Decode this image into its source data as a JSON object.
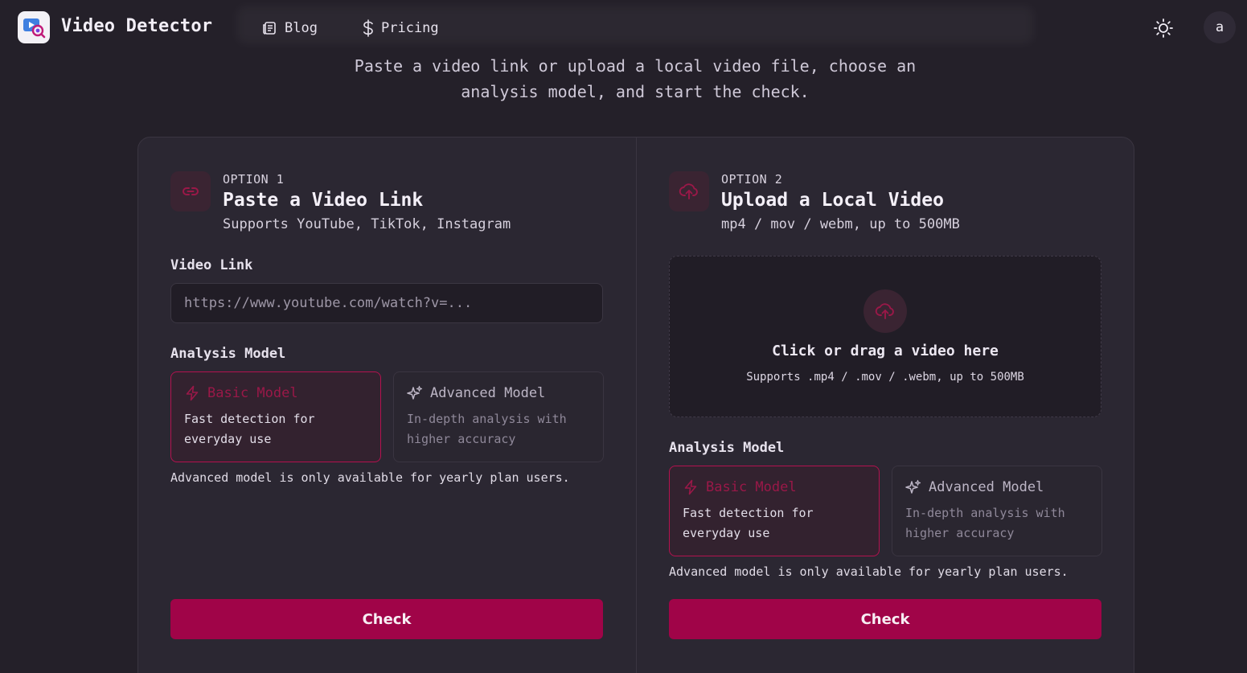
{
  "header": {
    "brand": "Video Detector",
    "nav": [
      {
        "label": "Blog",
        "icon": "newspaper-icon"
      },
      {
        "label": "Pricing",
        "icon": "dollar-icon"
      }
    ],
    "theme_icon": "sun-icon",
    "avatar_initial": "a"
  },
  "subtitle": "Paste a video link or upload a local video file, choose an analysis model, and start the check.",
  "option1": {
    "kicker": "OPTION 1",
    "title": "Paste a Video Link",
    "subtitle": "Supports YouTube, TikTok, Instagram",
    "field_label": "Video Link",
    "input_placeholder": "https://www.youtube.com/watch?v=...",
    "input_value": "",
    "model_label": "Analysis Model",
    "models": [
      {
        "name": "Basic Model",
        "desc": "Fast detection for everyday use",
        "selected": true
      },
      {
        "name": "Advanced Model",
        "desc": "In-depth analysis with higher accuracy",
        "selected": false
      }
    ],
    "note": "Advanced model is only available for yearly plan users.",
    "button": "Check"
  },
  "option2": {
    "kicker": "OPTION 2",
    "title": "Upload a Local Video",
    "subtitle": "mp4 / mov / webm, up to 500MB",
    "dropzone_title": "Click or drag a video here",
    "dropzone_sub": "Supports .mp4 / .mov / .webm, up to 500MB",
    "model_label": "Analysis Model",
    "models": [
      {
        "name": "Basic Model",
        "desc": "Fast detection for everyday use",
        "selected": true
      },
      {
        "name": "Advanced Model",
        "desc": "In-depth analysis with higher accuracy",
        "selected": false
      }
    ],
    "note": "Advanced model is only available for yearly plan users.",
    "button": "Check"
  },
  "colors": {
    "accent": "#a00448",
    "background": "#242029",
    "card": "#2b2732"
  }
}
